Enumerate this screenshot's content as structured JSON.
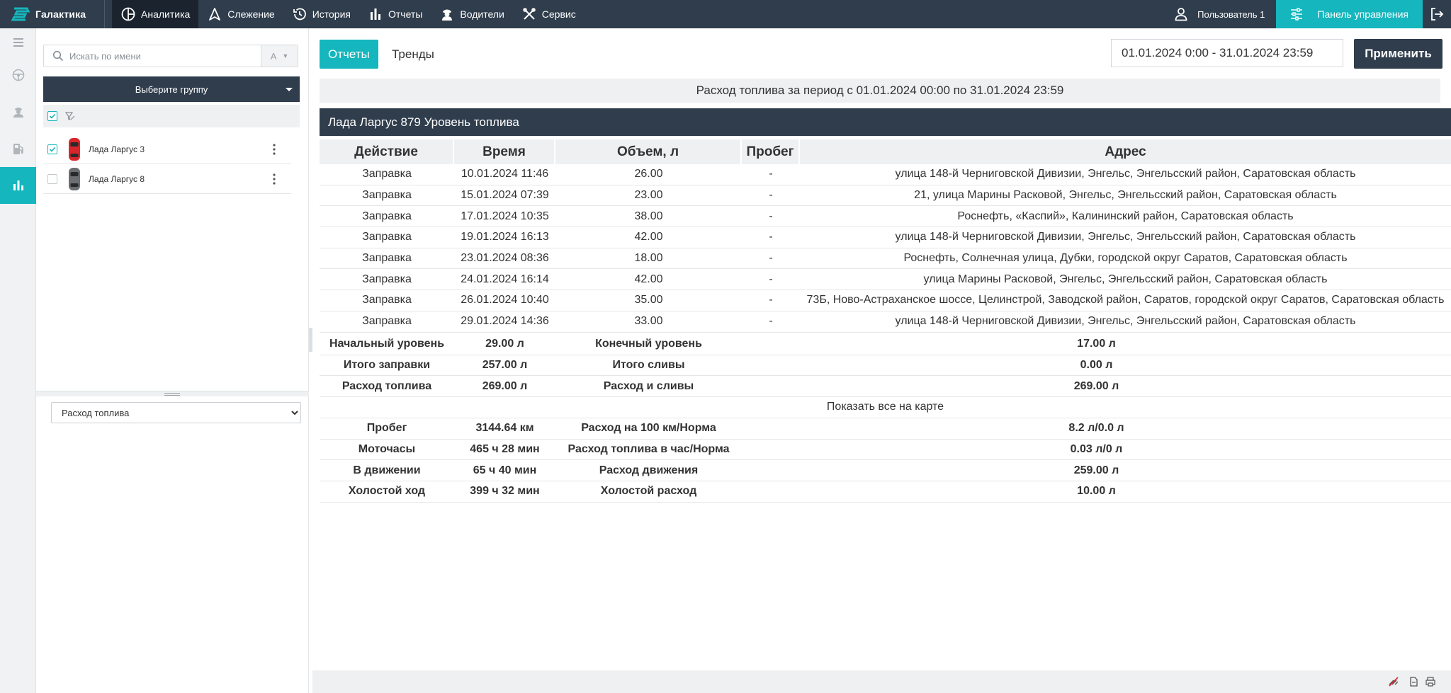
{
  "app": {
    "logo_text": "Галактика",
    "nav": [
      {
        "label": "Аналитика",
        "icon": "analytics-icon"
      },
      {
        "label": "Слежение",
        "icon": "tracking-icon"
      },
      {
        "label": "История",
        "icon": "history-icon"
      },
      {
        "label": "Отчеты",
        "icon": "reports-icon"
      },
      {
        "label": "Водители",
        "icon": "drivers-icon"
      },
      {
        "label": "Сервис",
        "icon": "service-icon"
      }
    ],
    "user_label": "Пользователь 1",
    "panel_label": "Панель управления",
    "accent_color": "#15b6bd",
    "dark_color": "#2f3d4c"
  },
  "rail": [
    "menu-icon",
    "steering-wheel-icon",
    "driver-icon",
    "fuel-icon",
    "chart-icon"
  ],
  "sidebar": {
    "search_placeholder": "Искать по имени",
    "sort_label": "А",
    "group_label": "Выберите группу",
    "units": [
      {
        "name": "Лада Ларгус 3",
        "checked": true,
        "color": "#d9262c"
      },
      {
        "name": "Лада Ларгус 8",
        "checked": false,
        "color": "#6c6f72"
      }
    ],
    "report_type": "Расход топлива"
  },
  "main": {
    "tabs": [
      "Отчеты",
      "Тренды"
    ],
    "date_range": "01.01.2024 0:00 - 31.01.2024 23:59",
    "apply_label": "Применить",
    "period_text": "Расход топлива за период с 01.01.2024 00:00 по 31.01.2024 23:59",
    "unit_title": "Лада Ларгус 879 Уровень топлива",
    "columns": [
      "Действие",
      "Время",
      "Объем, л",
      "Пробег",
      "Адрес"
    ],
    "events": [
      [
        "Заправка",
        "10.01.2024 11:46",
        "26.00",
        "-",
        "улица 148-й Черниговской Дивизии, Энгельс, Энгельсский район, Саратовская область"
      ],
      [
        "Заправка",
        "15.01.2024 07:39",
        "23.00",
        "-",
        "21, улица Марины Расковой, Энгельс, Энгельсский район, Саратовская область"
      ],
      [
        "Заправка",
        "17.01.2024 10:35",
        "38.00",
        "-",
        "Роснефть, «Каспий», Калининский район, Саратовская область"
      ],
      [
        "Заправка",
        "19.01.2024 16:13",
        "42.00",
        "-",
        "улица 148-й Черниговской Дивизии, Энгельс, Энгельсский район, Саратовская область"
      ],
      [
        "Заправка",
        "23.01.2024 08:36",
        "18.00",
        "-",
        "Роснефть, Солнечная улица, Дубки, городской округ Саратов, Саратовская область"
      ],
      [
        "Заправка",
        "24.01.2024 16:14",
        "42.00",
        "-",
        "улица Марины Расковой, Энгельс, Энгельсский район, Саратовская область"
      ],
      [
        "Заправка",
        "26.01.2024 10:40",
        "35.00",
        "-",
        "73Б, Ново-Астраханское шоссе, Целинстрой, Заводской район, Саратов, городской округ Саратов, Саратовская область"
      ],
      [
        "Заправка",
        "29.01.2024 14:36",
        "33.00",
        "-",
        "улица 148-й Черниговской Дивизии, Энгельс, Энгельсский район, Саратовская область"
      ]
    ],
    "summary1": [
      [
        "Начальный уровень",
        "29.00 л",
        "Конечный уровень",
        "17.00 л"
      ],
      [
        "Итого заправки",
        "257.00 л",
        "Итого сливы",
        "0.00 л"
      ],
      [
        "Расход топлива",
        "269.00 л",
        "Расход и сливы",
        "269.00 л"
      ]
    ],
    "show_map": "Показать все на карте",
    "summary2": [
      [
        "Пробег",
        "3144.64 км",
        "Расход на 100 км/Норма",
        "8.2 л/0.0 л"
      ],
      [
        "Моточасы",
        "465 ч 28 мин",
        "Расход топлива в час/Норма",
        "0.03 л/0 л"
      ],
      [
        "В движении",
        "65 ч 40 мин",
        "Расход движения",
        "259.00 л"
      ],
      [
        "Холостой ход",
        "399 ч 32 мин",
        "Холостой расход",
        "10.00 л"
      ]
    ]
  }
}
